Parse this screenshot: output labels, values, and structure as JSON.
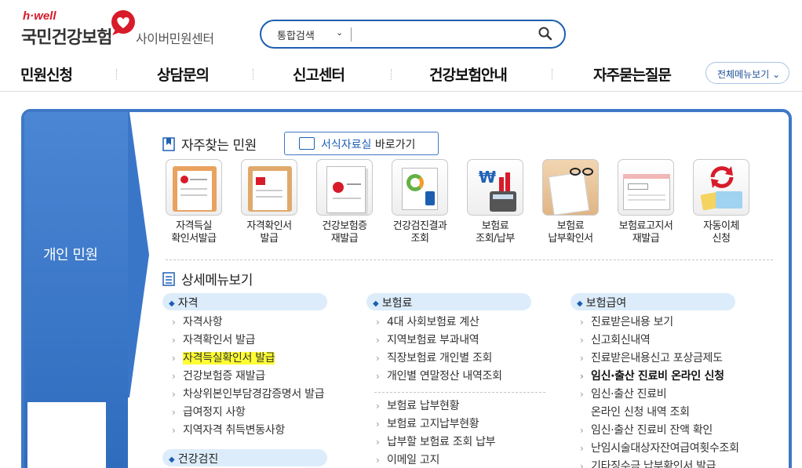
{
  "header": {
    "logo_hwell": "h·well",
    "logo_brand": "국민건강보험",
    "logo_sub": "사이버민원센터",
    "search_scope": "통합검색",
    "search_placeholder": ""
  },
  "nav": {
    "items": [
      "민원신청",
      "상담문의",
      "신고센터",
      "건강보험안내",
      "자주묻는질문"
    ],
    "all_menu": "전체메뉴보기"
  },
  "sidebar": {
    "label": "개인 민원"
  },
  "frequent": {
    "title": "자주찾는 민원",
    "form_button_blue": "서식자료실",
    "form_button_rest": " 바로가기",
    "items": [
      {
        "line1": "자격득실",
        "line2": "확인서발급",
        "icon": "document-clipboard-icon"
      },
      {
        "line1": "자격확인서",
        "line2": "발급",
        "icon": "certificate-clipboard-icon"
      },
      {
        "line1": "건강보험증",
        "line2": "재발급",
        "icon": "insurance-card-icon"
      },
      {
        "line1": "건강검진결과",
        "line2": "조회",
        "icon": "health-checkup-chart-icon"
      },
      {
        "line1": "보험료",
        "line2": "조회/납부",
        "icon": "calculator-won-icon"
      },
      {
        "line1": "보험료",
        "line2": "납부확인서",
        "icon": "receipt-glasses-icon"
      },
      {
        "line1": "보험료고지서",
        "line2": "재발급",
        "icon": "bill-notice-icon"
      },
      {
        "line1": "자동이체",
        "line2": "신청",
        "icon": "auto-transfer-card-icon"
      }
    ]
  },
  "detail": {
    "title": "상세메뉴보기",
    "col1": {
      "header": "자격",
      "items": [
        "자격사항",
        "자격확인서 발급",
        "자격득실확인서 발급",
        "건강보험증 재발급",
        "차상위본인부담경감증명서 발급",
        "급여정지 사항",
        "지역자격 취득변동사항"
      ],
      "header2": "건강검진"
    },
    "col2": {
      "header": "보험료",
      "items": [
        "4대 사회보험료 계산",
        "지역보험료 부과내역",
        "직장보험료 개인별 조회",
        "개인별 연말정산 내역조회"
      ],
      "items2": [
        "보험료 납부현황",
        "보험료 고지납부현황",
        "납부할 보험료 조회 납부",
        "이메일 고지"
      ]
    },
    "col3": {
      "header": "보험급여",
      "items": [
        "진료받은내용 보기",
        "신고회신내역",
        "진료받은내용신고 포상금제도"
      ],
      "bold_item": "임신·출산 진료비 온라인 신청",
      "multi_line1": "임신·출산 진료비",
      "multi_line2": "온라인 신청 내역 조회",
      "items2": [
        "임신·출산 진료비 잔액 확인",
        "난임시술대상자잔여급여횟수조회",
        "기타징수금 납부확인서 발급"
      ]
    }
  },
  "colors": {
    "accent": "#3f78c6",
    "pill": "#dcecfa",
    "highlight": "#ffff33",
    "brand_red": "#d71b2a"
  }
}
